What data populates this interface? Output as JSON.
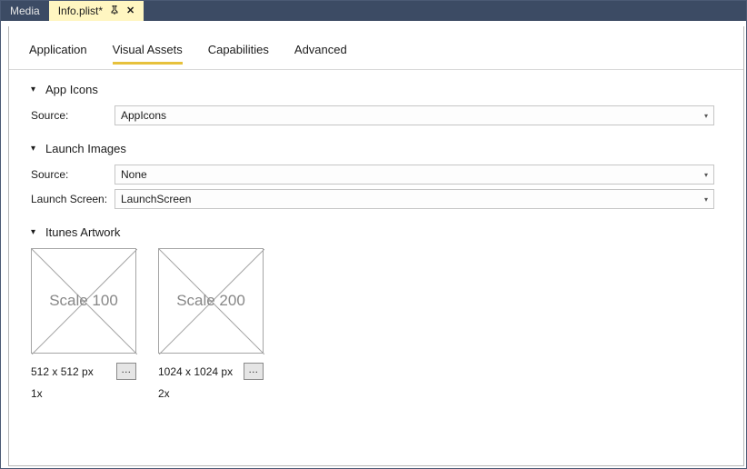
{
  "tabs": {
    "media": "Media",
    "info": "Info.plist*"
  },
  "subtabs": {
    "application": "Application",
    "visual": "Visual Assets",
    "capabilities": "Capabilities",
    "advanced": "Advanced"
  },
  "sections": {
    "appicons": {
      "title": "App Icons",
      "source_label": "Source:",
      "source_value": "AppIcons"
    },
    "launch": {
      "title": "Launch Images",
      "source_label": "Source:",
      "source_value": "None",
      "screen_label": "Launch Screen:",
      "screen_value": "LaunchScreen"
    },
    "itunes": {
      "title": "Itunes Artwork",
      "items": [
        {
          "placeholder": "Scale 100",
          "dim": "512 x 512 px",
          "scale": "1x"
        },
        {
          "placeholder": "Scale 200",
          "dim": "1024 x 1024 px",
          "scale": "2x"
        }
      ]
    }
  },
  "glyphs": {
    "pin": "⊸",
    "close": "✕",
    "chev": "▾",
    "caret": "▾",
    "dots": "..."
  }
}
